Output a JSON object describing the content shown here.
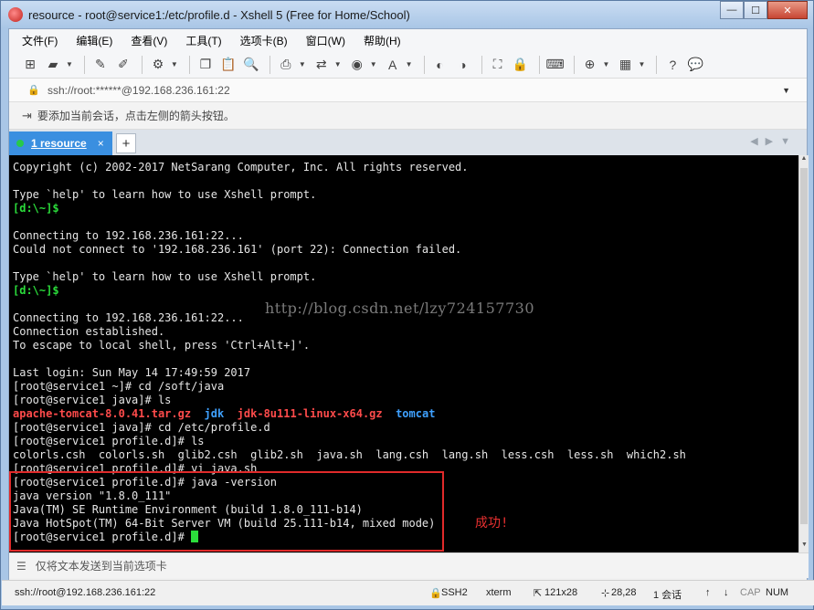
{
  "window": {
    "title": "resource - root@service1:/etc/profile.d - Xshell 5 (Free for Home/School)",
    "minimize": "—",
    "maximize": "☐",
    "close": "✕"
  },
  "menu": [
    "文件(F)",
    "编辑(E)",
    "查看(V)",
    "工具(T)",
    "选项卡(B)",
    "窗口(W)",
    "帮助(H)"
  ],
  "address": {
    "value": "ssh://root:******@192.168.236.161:22"
  },
  "hint": {
    "text": "要添加当前会话，点击左侧的箭头按钮。"
  },
  "tab": {
    "label": "1 resource",
    "close": "×",
    "add": "+"
  },
  "terminal": {
    "lines": [
      "Copyright (c) 2002-2017 NetSarang Computer, Inc. All rights reserved.",
      "",
      "Type `help' to learn how to use Xshell prompt.",
      "[d:\\~]$",
      "",
      "Connecting to 192.168.236.161:22...",
      "Could not connect to '192.168.236.161' (port 22): Connection failed.",
      "",
      "Type `help' to learn how to use Xshell prompt.",
      "[d:\\~]$",
      "",
      "Connecting to 192.168.236.161:22...",
      "Connection established.",
      "To escape to local shell, press 'Ctrl+Alt+]'.",
      "",
      "Last login: Sun May 14 17:49:59 2017",
      "[root@service1 ~]# cd /soft/java",
      "[root@service1 java]# ls",
      "",
      "[root@service1 java]# cd /etc/profile.d",
      "[root@service1 profile.d]# ls",
      "colorls.csh  colorls.sh  glib2.csh  glib2.sh  java.sh  lang.csh  lang.sh  less.csh  less.sh  which2.sh",
      "[root@service1 profile.d]# vi java.sh",
      "[root@service1 profile.d]# java -version",
      "java version \"1.8.0_111\"",
      "Java(TM) SE Runtime Environment (build 1.8.0_111-b14)",
      "Java HotSpot(TM) 64-Bit Server VM (build 25.111-b14, mixed mode)",
      "[root@service1 profile.d]# "
    ],
    "ls_java": {
      "file1": "apache-tomcat-8.0.41.tar.gz",
      "dir1": "jdk",
      "file2": "jdk-8u111-linux-x64.gz",
      "dir2": "tomcat"
    },
    "watermark": "http://blog.csdn.net/lzy724157730",
    "annotation": "成功!"
  },
  "sendbar": {
    "text": "仅将文本发送到当前选项卡"
  },
  "status": {
    "connection": "ssh://root@192.168.236.161:22",
    "protocol": "SSH2",
    "term": "xterm",
    "size": "121x28",
    "cursor_pos": "28,28",
    "sessions": "1 会话",
    "cap": "CAP",
    "num": "NUM"
  },
  "colors": {
    "prompt_green": "#2bdc3b",
    "archive_red": "#ff4b4b",
    "dir_blue": "#3fa1ff",
    "tab_blue": "#3a8fe0",
    "highlight_red": "#e02a2a"
  }
}
